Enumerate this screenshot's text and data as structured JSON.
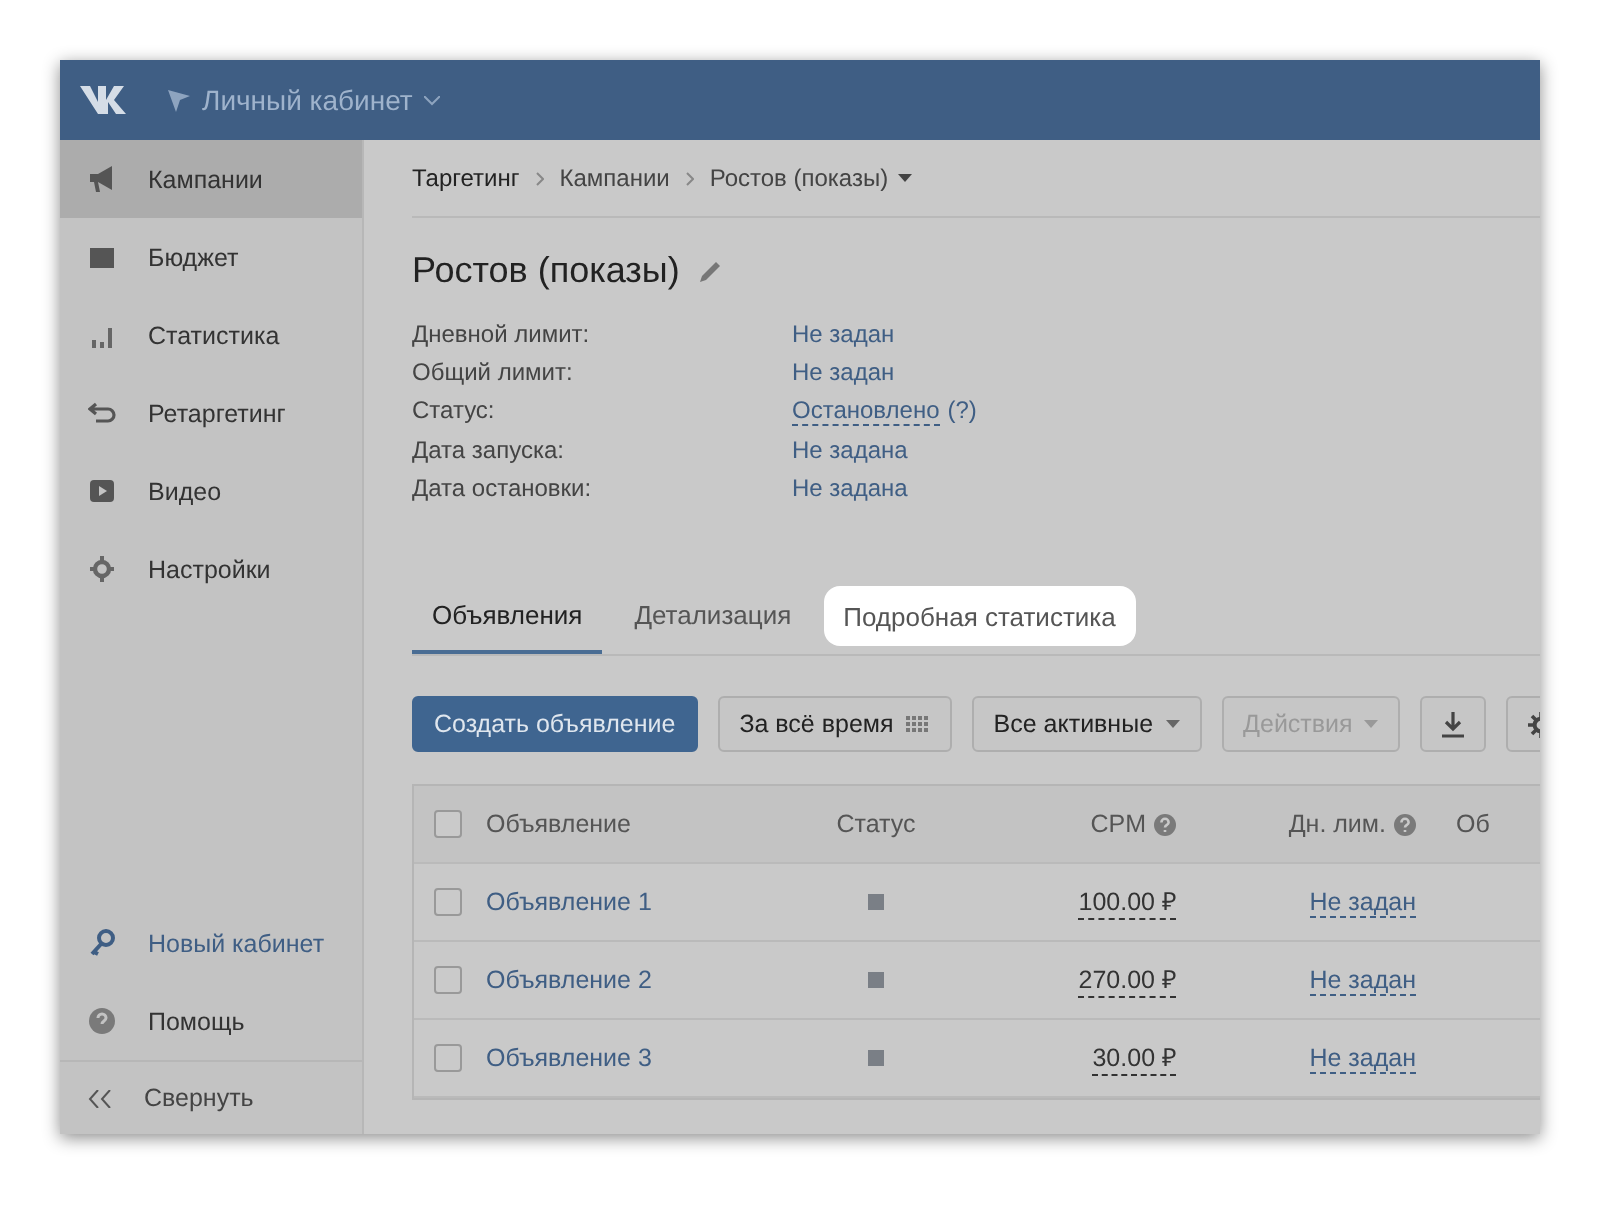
{
  "header": {
    "account": "Личный кабинет"
  },
  "sidebar": {
    "items": [
      {
        "label": "Кампании",
        "selected": true
      },
      {
        "label": "Бюджет",
        "selected": false
      },
      {
        "label": "Статистика",
        "selected": false
      },
      {
        "label": "Ретаргетинг",
        "selected": false
      },
      {
        "label": "Видео",
        "selected": false
      },
      {
        "label": "Настройки",
        "selected": false
      }
    ],
    "bottom": [
      {
        "label": "Новый кабинет",
        "kind": "link"
      },
      {
        "label": "Помощь",
        "kind": "plain"
      }
    ],
    "collapse": "Свернуть"
  },
  "breadcrumbs": [
    "Таргетинг",
    "Кампании",
    "Ростов (показы)"
  ],
  "campaign": {
    "title": "Ростов (показы)",
    "fields": [
      {
        "label": "Дневной лимит:",
        "value": "Не задан"
      },
      {
        "label": "Общий лимит:",
        "value": "Не задан"
      },
      {
        "label": "Статус:",
        "value": "Остановлено",
        "note": "(?)"
      },
      {
        "label": "Дата запуска:",
        "value": "Не задана"
      },
      {
        "label": "Дата остановки:",
        "value": "Не задана"
      }
    ]
  },
  "tabs": [
    {
      "label": "Объявления",
      "selected": true,
      "highlighted": false
    },
    {
      "label": "Детализация",
      "selected": false,
      "highlighted": false
    },
    {
      "label": "Подробная статистика",
      "selected": false,
      "highlighted": true
    }
  ],
  "toolbar": {
    "create": "Создать объявление",
    "period": "За всё время",
    "filter": "Все активные",
    "actions": "Действия",
    "actions_disabled": true
  },
  "table": {
    "all_checked": false,
    "columns": [
      {
        "label": "Объявление",
        "help": false
      },
      {
        "label": "Статус",
        "help": false
      },
      {
        "label": "CPM",
        "help": true
      },
      {
        "label": "Дн. лим.",
        "help": true
      },
      {
        "label": "Об",
        "help": false
      }
    ],
    "rows": [
      {
        "name": "Объявление 1",
        "checked": false,
        "cpm": "100.00 ₽",
        "limit": "Не задан"
      },
      {
        "name": "Объявление 2",
        "checked": false,
        "cpm": "270.00 ₽",
        "limit": "Не задан"
      },
      {
        "name": "Объявление 3",
        "checked": false,
        "cpm": "30.00 ₽",
        "limit": "Не задан"
      }
    ]
  }
}
